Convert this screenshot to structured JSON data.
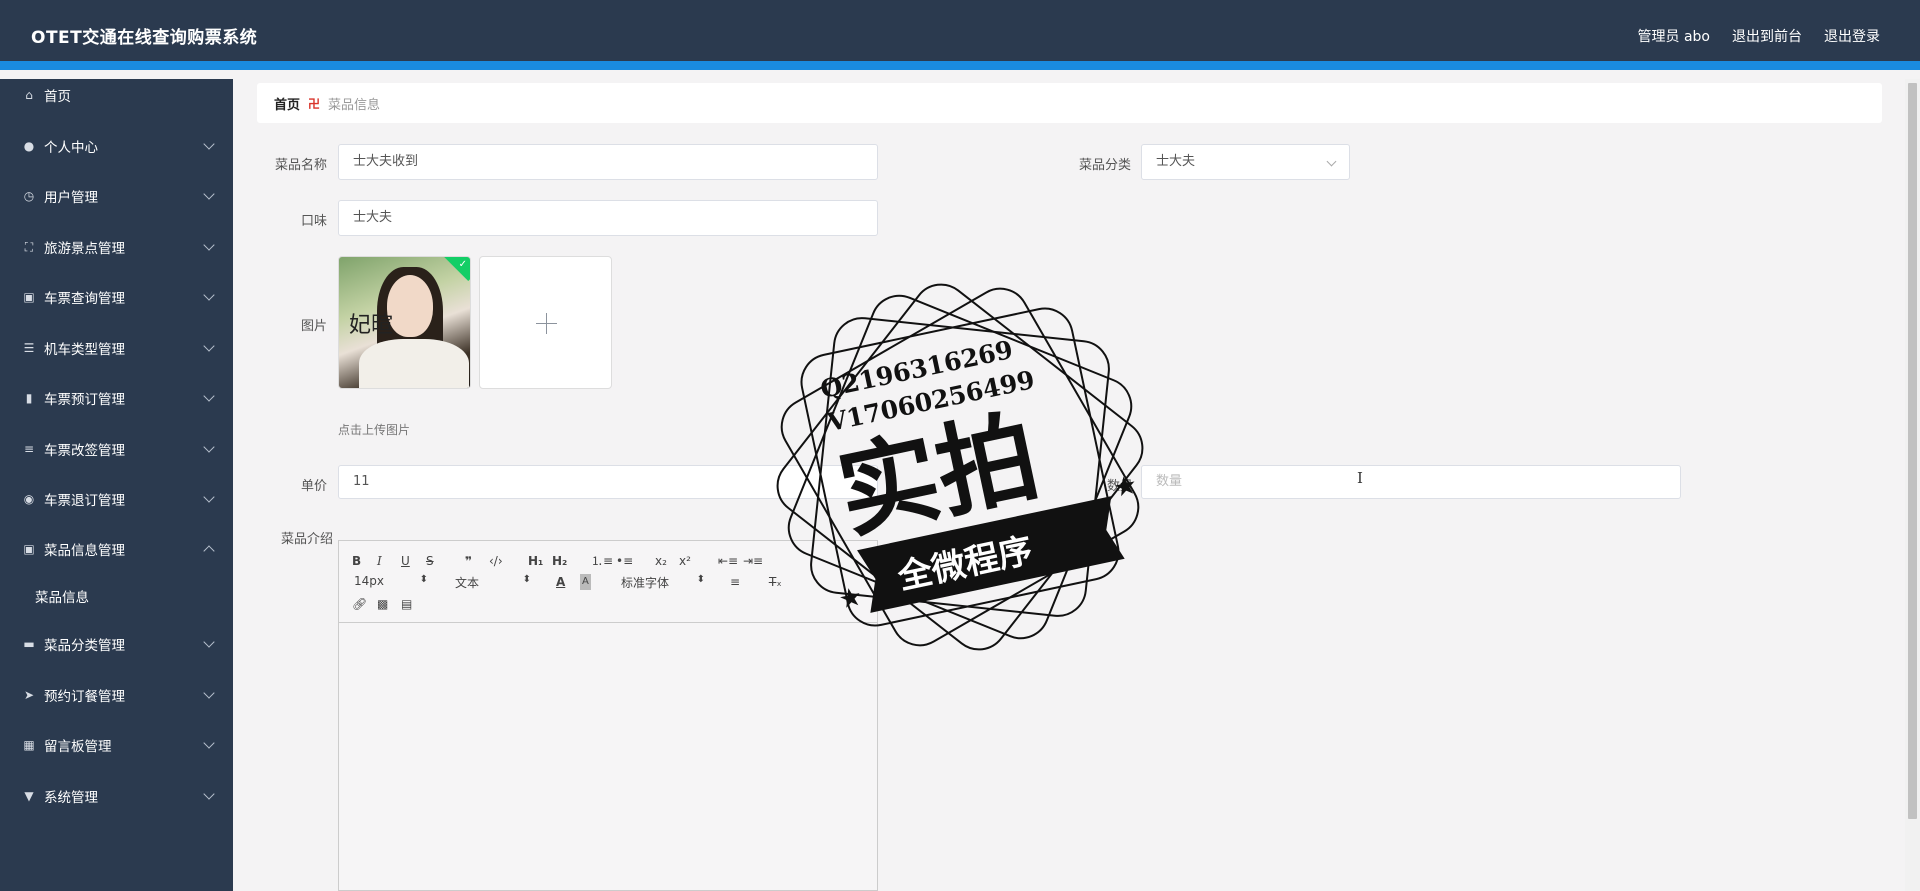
{
  "header": {
    "title": "OTET交通在线查询购票系统",
    "admin_label": "管理员 abo",
    "to_front": "退出到前台",
    "logout": "退出登录"
  },
  "sidebar": {
    "items": [
      {
        "label": "首页",
        "icon": "home-icon"
      },
      {
        "label": "个人中心",
        "icon": "user-icon"
      },
      {
        "label": "用户管理",
        "icon": "clock-icon"
      },
      {
        "label": "旅游景点管理",
        "icon": "expand-icon"
      },
      {
        "label": "车票查询管理",
        "icon": "clipboard-icon"
      },
      {
        "label": "机车类型管理",
        "icon": "list-icon"
      },
      {
        "label": "车票预订管理",
        "icon": "microphone-icon"
      },
      {
        "label": "车票改签管理",
        "icon": "sliders-icon"
      },
      {
        "label": "车票退订管理",
        "icon": "location-icon"
      },
      {
        "label": "菜品信息管理",
        "icon": "clipboard-icon"
      },
      {
        "label": "菜品分类管理",
        "icon": "monitor-icon"
      },
      {
        "label": "预约订餐管理",
        "icon": "send-icon"
      },
      {
        "label": "留言板管理",
        "icon": "grid-icon"
      },
      {
        "label": "系统管理",
        "icon": "pin-icon"
      }
    ],
    "subitem": "菜品信息"
  },
  "breadcrumb": {
    "home": "首页",
    "current": "菜品信息"
  },
  "form": {
    "name_label": "菜品名称",
    "name_value": "士大夫收到",
    "category_label": "菜品分类",
    "category_value": "士大夫",
    "taste_label": "口味",
    "taste_value": "士大夫",
    "image_label": "图片",
    "image_calligraphy": "妃暄",
    "upload_hint": "点击上传图片",
    "price_label": "单价",
    "price_value": "11",
    "qty_label": "数量",
    "qty_placeholder": "数量",
    "intro_label": "菜品介绍"
  },
  "editor": {
    "font_size": "14px",
    "header_select": "文本",
    "font_family": "标准字体"
  },
  "watermark": {
    "line1": "Q2196316269",
    "line2": "V17060256499",
    "big": "实拍",
    "banner": "全微程序"
  }
}
